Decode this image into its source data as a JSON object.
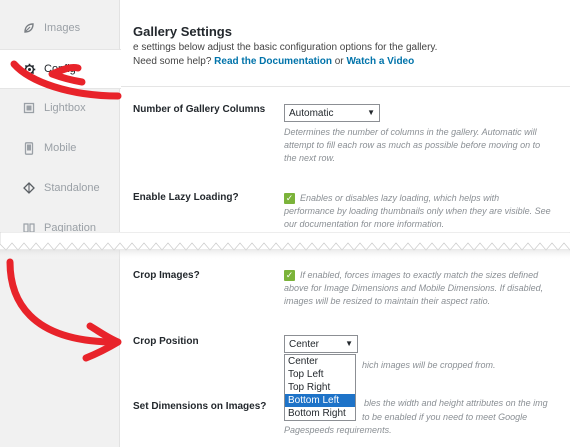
{
  "sidebar": {
    "items": [
      {
        "label": "Images",
        "icon": "leaf-icon"
      },
      {
        "label": "Config",
        "icon": "gear-icon"
      },
      {
        "label": "Lightbox",
        "icon": "lightbox-icon"
      },
      {
        "label": "Mobile",
        "icon": "mobile-icon"
      },
      {
        "label": "Standalone",
        "icon": "standalone-icon"
      },
      {
        "label": "Pagination",
        "icon": "pagination-icon"
      }
    ]
  },
  "header": {
    "title": "Gallery Settings",
    "intro_line1": "e settings below adjust the basic configuration options for the gallery.",
    "help_prefix": "Need some help?",
    "doc_link": "Read the Documentation",
    "or_text": "or",
    "video_link": "Watch a Video"
  },
  "settings": {
    "columns": {
      "label": "Number of Gallery Columns",
      "value": "Automatic",
      "description": "Determines the number of columns in the gallery. Automatic will attempt to fill each row as much as possible before moving on to the next row."
    },
    "lazy": {
      "label": "Enable Lazy Loading?",
      "checked": true,
      "description": "Enables or disables lazy loading, which helps with performance by loading thumbnails only when they are visible. See our documentation for more information."
    },
    "crop": {
      "label": "Crop Images?",
      "checked": true,
      "description": "If enabled, forces images to exactly match the sizes defined above for Image Dimensions and Mobile Dimensions. If disabled, images will be resized to maintain their aspect ratio."
    },
    "crop_position": {
      "label": "Crop Position",
      "value": "Center",
      "options": [
        "Center",
        "Top Left",
        "Top Right",
        "Bottom Left",
        "Bottom Right"
      ],
      "highlighted": "Bottom Left",
      "description_partial": "hich images will be cropped from."
    },
    "dimensions": {
      "label": "Set Dimensions on Images?",
      "desc_line1": "bles the width and height attributes on the img",
      "desc_line2": "to be enabled if you need to meet Google",
      "desc_line3": "Pagespeeds requirements."
    }
  },
  "colors": {
    "annotation_red": "#e8232a",
    "link_blue": "#0073aa",
    "check_green": "#7bb33a",
    "highlight_blue": "#1e73c8"
  }
}
